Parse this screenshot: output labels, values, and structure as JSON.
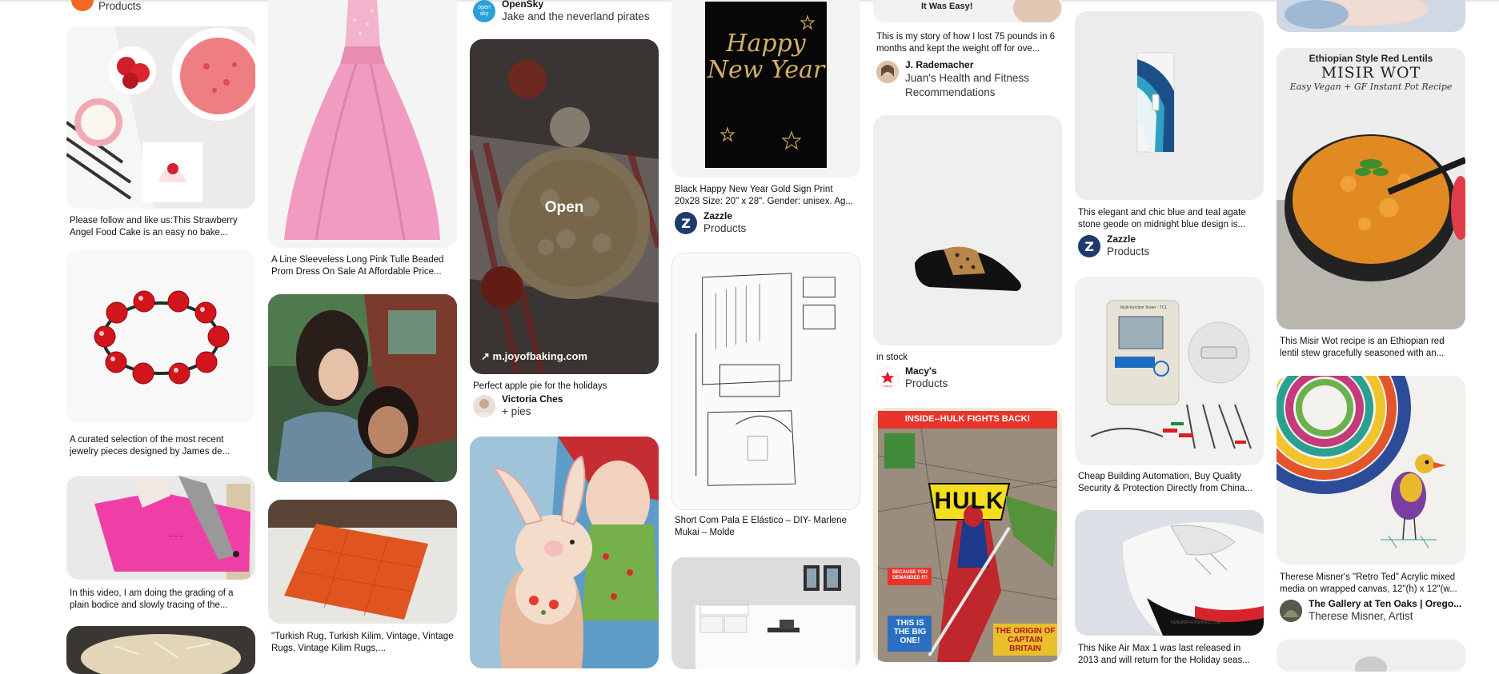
{
  "columns": [
    {
      "pins": [
        {
          "by_sub": "Products"
        },
        {
          "caption": "Please follow and like us:This Strawberry Angel Food Cake is an easy no bake..."
        },
        {
          "caption": "A curated selection of the most recent jewelry pieces designed by James de..."
        },
        {
          "caption": "In this video, I am doing the grading of a plain bodice and slowly tracing of the..."
        }
      ]
    },
    {
      "pins": [
        {
          "caption": "A Line Sleeveless Long Pink Tulle Beaded Prom Dress On Sale At Affordable Price..."
        },
        {},
        {
          "caption": "\"Turkish Rug, Turkish Kilim, Vintage, Vintage Rugs, Vintage Kilim Rugs,..."
        }
      ]
    },
    {
      "pins": [
        {
          "by_name": "OpenSky",
          "by_sub": "Jake and the neverland pirates",
          "avatar_text": "open sky"
        },
        {
          "overlay_title": "Open",
          "source_link": "m.joyofbaking.com",
          "caption": "Perfect apple pie for the holidays",
          "by_name": "Victoria Ches",
          "by_sub": "+ pies"
        },
        {}
      ]
    },
    {
      "pins": [
        {
          "image_text": "Happy New Year",
          "caption": "Black Happy New Year Gold Sign Print 20x28 Size: 20\" x 28\". Gender: unisex. Ag...",
          "by_name": "Zazzle",
          "by_sub": "Products"
        },
        {
          "caption": "Short Com Pala E Elástico – DIY- Marlene Mukai – Molde"
        },
        {}
      ]
    },
    {
      "pins": [
        {
          "image_text": "It Was Easy!",
          "caption": "This is my story of how I lost 75 pounds in 6 months and kept the weight off for ove...",
          "by_name": "J. Rademacher",
          "by_sub": "Juan's Health and Fitness Recommendations"
        },
        {
          "caption": "in stock",
          "by_name": "Macy's",
          "by_sub": "Products",
          "avatar_text": "macys"
        },
        {
          "image_text": {
            "top": "INSIDE--HULK FIGHTS BACK!",
            "logo": "HULK",
            "badge": "THIS IS THE BIG ONE!",
            "story": "THE ORIGIN OF CAPTAIN BRITAIN",
            "blurb": "BECAUSE YOU DEMANDED IT!"
          }
        }
      ]
    },
    {
      "pins": [
        {
          "caption": "This elegant and chic blue and teal agate stone geode on midnight blue design is...",
          "by_name": "Zazzle",
          "by_sub": "Products"
        },
        {
          "image_text": "Multi-function Tester - TC1",
          "caption": "Cheap Building Automation, Buy Quality Security & Protection Directly from China..."
        },
        {
          "image_text": "KENGRIFFEYSHOES.COM",
          "caption": "This Nike Air Max 1 was last released in 2013 and will return for the Holiday seas..."
        }
      ]
    },
    {
      "pins": [
        {},
        {
          "image_text": {
            "line1": "Ethiopian Style Red Lentils",
            "line2": "MISIR WOT",
            "line3": "Easy Vegan + GF Instant Pot Recipe"
          },
          "caption": "This Misir Wot recipe is an Ethiopian red lentil stew gracefully seasoned with an..."
        },
        {
          "caption": "Therese Misner's \"Retro Ted\" Acrylic mixed media on wrapped canvas, 12\"(h) x 12\"(w...",
          "by_name": "The Gallery at Ten Oaks | Orego...",
          "by_sub": "Therese Misner, Artist"
        },
        {}
      ]
    }
  ],
  "colors": {
    "zazzle": "#1f3b6e",
    "macys": "#e21a2c",
    "opensky": "#2aa0d8",
    "card_bg": "#efefef"
  }
}
